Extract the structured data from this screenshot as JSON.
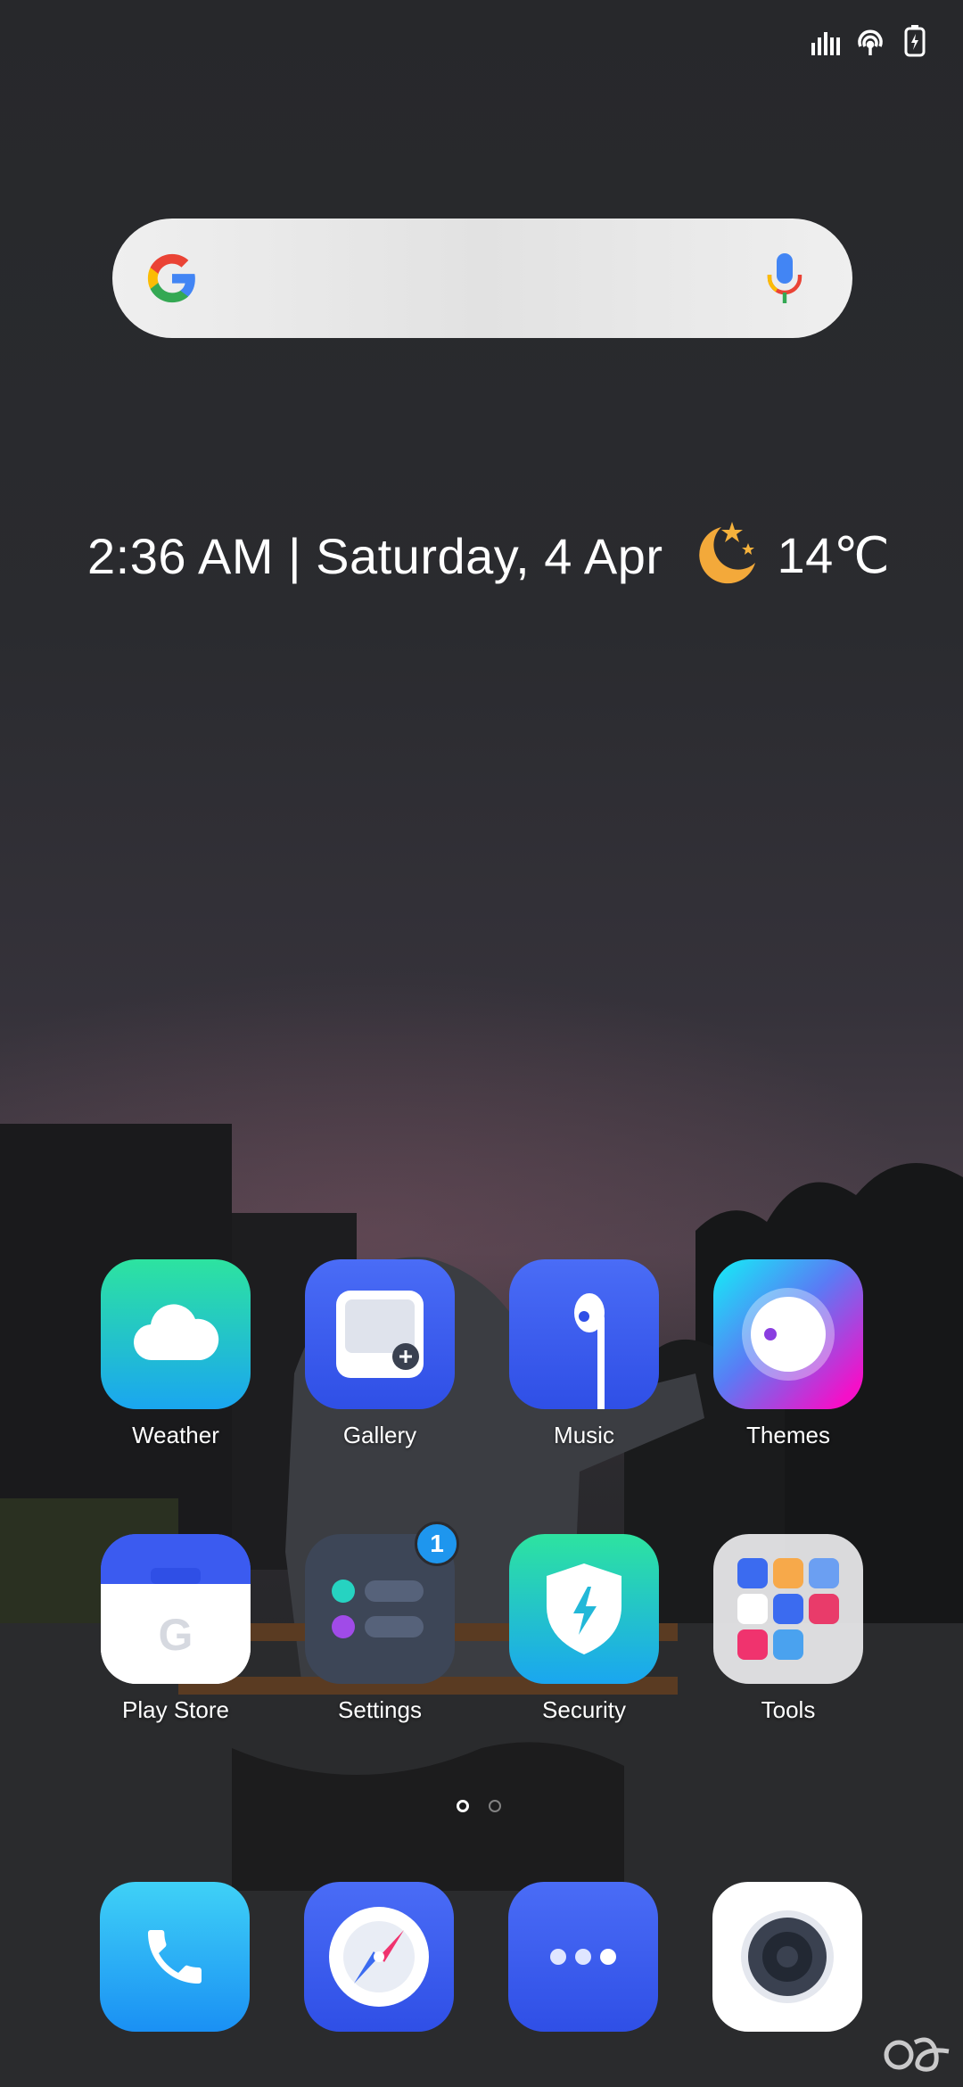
{
  "status_bar": {
    "icons": [
      "signal-icon",
      "hotspot-icon",
      "battery-charging-icon"
    ]
  },
  "search_bar": {
    "logo": "google-logo",
    "voice_icon": "microphone-icon"
  },
  "clock_widget": {
    "time_date": "2:36 AM | Saturday, 4 Apr",
    "weather_icon": "night-moon-stars-icon",
    "temperature": "14℃"
  },
  "apps": [
    {
      "label": "Weather",
      "icon": "cloud-icon"
    },
    {
      "label": "Gallery",
      "icon": "gallery-icon"
    },
    {
      "label": "Music",
      "icon": "earphone-icon"
    },
    {
      "label": "Themes",
      "icon": "themes-icon"
    },
    {
      "label": "Play Store",
      "icon": "shopping-bag-icon"
    },
    {
      "label": "Settings",
      "icon": "settings-toggles-icon",
      "badge": "1"
    },
    {
      "label": "Security",
      "icon": "shield-bolt-icon"
    },
    {
      "label": "Tools",
      "icon": "folder-icon"
    }
  ],
  "pager": {
    "pages": 2,
    "current": 1
  },
  "dock": [
    {
      "icon": "phone-icon"
    },
    {
      "icon": "browser-compass-icon"
    },
    {
      "icon": "messaging-icon"
    },
    {
      "icon": "camera-icon"
    }
  ],
  "colors": {
    "badge": "#1e96ee",
    "accent_blue": "#3b5bf0"
  }
}
